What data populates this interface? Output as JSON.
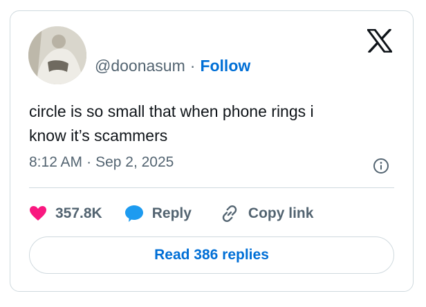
{
  "user": {
    "handle": "@doonasum",
    "separator": "·",
    "follow_label": "Follow"
  },
  "tweet": {
    "text_line1": "circle is so small that when phone rings i",
    "text_line2": "know it’s scammers",
    "time": "8:12 AM",
    "separator": "·",
    "date": "Sep 2, 2025"
  },
  "actions": {
    "likes": "357.8K",
    "reply_label": "Reply",
    "copy_link_label": "Copy link"
  },
  "read_replies_label": "Read 386 replies",
  "icons": {
    "brand": "x-logo-icon",
    "info": "info-icon",
    "like": "heart-icon",
    "reply": "speech-bubble-icon",
    "link": "link-icon"
  },
  "colors": {
    "like": "#f91880",
    "reply": "#1d9bf0",
    "link_text": "#006fd6",
    "muted": "#536471",
    "border": "#cfd9de"
  }
}
